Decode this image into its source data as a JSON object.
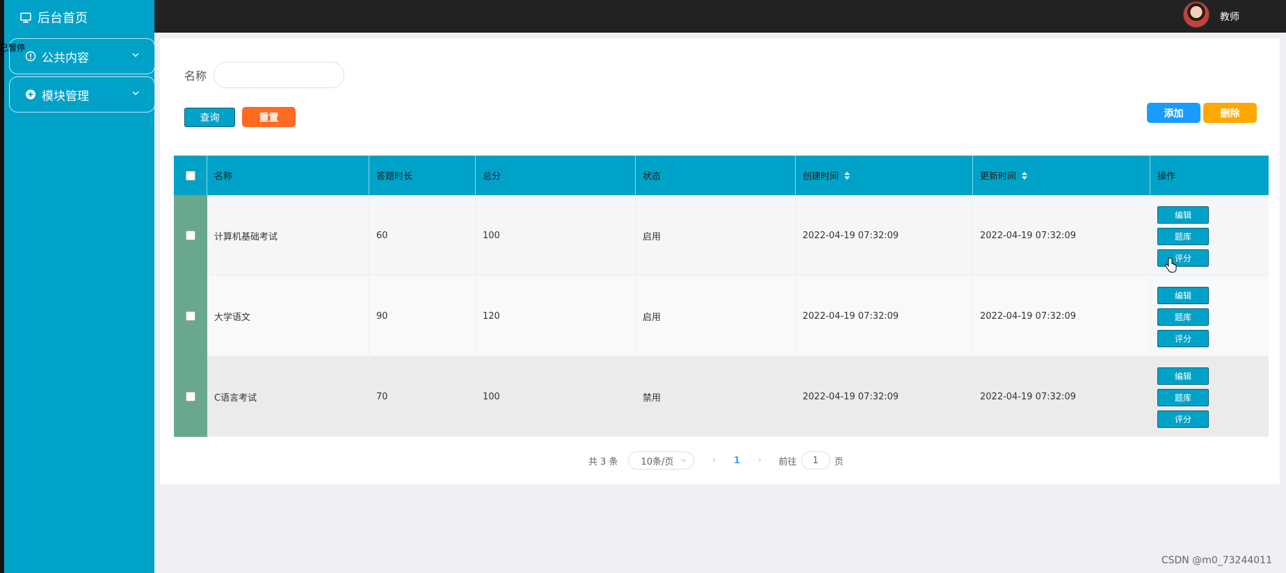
{
  "sidebar": {
    "home_label": "后台首页",
    "overlay_tag": "已暂停",
    "groups": [
      {
        "label": "公共内容",
        "icon": "info-circle-icon"
      },
      {
        "label": "模块管理",
        "icon": "plus-circle-icon"
      }
    ]
  },
  "topbar": {
    "role": "教师",
    "avatar_icon": "user-avatar"
  },
  "search": {
    "label": "名称",
    "value": "",
    "placeholder": ""
  },
  "buttons": {
    "query": "查询",
    "reset": "重置",
    "add": "添加",
    "delete": "删除"
  },
  "table": {
    "headers": [
      "名称",
      "答题时长",
      "总分",
      "状态",
      "创建时间",
      "更新时间",
      "操作"
    ],
    "sortable": [
      "创建时间",
      "更新时间"
    ],
    "rows": [
      {
        "name": "计算机基础考试",
        "duration": "60",
        "score": "100",
        "status": "启用",
        "created": "2022-04-19 07:32:09",
        "updated": "2022-04-19 07:32:09"
      },
      {
        "name": "大学语文",
        "duration": "90",
        "score": "120",
        "status": "启用",
        "created": "2022-04-19 07:32:09",
        "updated": "2022-04-19 07:32:09"
      },
      {
        "name": "C语言考试",
        "duration": "70",
        "score": "100",
        "status": "禁用",
        "created": "2022-04-19 07:32:09",
        "updated": "2022-04-19 07:32:09"
      }
    ],
    "row_actions": [
      "编辑",
      "题库",
      "评分"
    ]
  },
  "pagination": {
    "total": "共 3 条",
    "page_size": "10条/页",
    "current_page": "1",
    "goto_label": "前往",
    "goto_value": "1",
    "page_suffix": "页"
  },
  "watermark": "CSDN @m0_73244011",
  "colors": {
    "primary": "#00a2c8",
    "reset": "#ff6a21",
    "add": "#1a9cff",
    "delete": "#ffa800",
    "row_select": "#6aa88e"
  }
}
